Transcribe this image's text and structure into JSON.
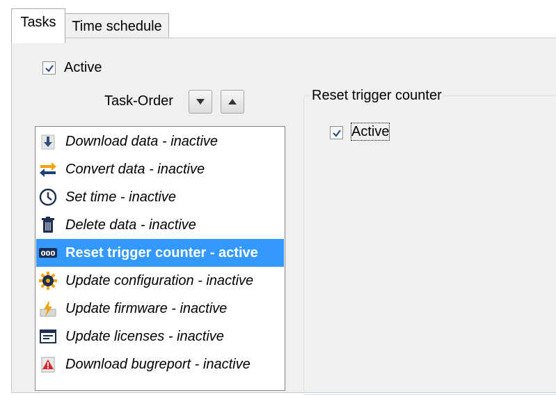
{
  "tabs": [
    {
      "label": "Tasks",
      "active": true
    },
    {
      "label": "Time schedule",
      "active": false
    }
  ],
  "main_active": {
    "label": "Active",
    "checked": true
  },
  "task_order": {
    "label": "Task-Order"
  },
  "tasks": [
    {
      "label": "Download data - inactive",
      "icon": "download-icon"
    },
    {
      "label": "Convert data - inactive",
      "icon": "convert-arrows-icon"
    },
    {
      "label": "Set time - inactive",
      "icon": "clock-icon"
    },
    {
      "label": "Delete data - inactive",
      "icon": "trash-icon"
    },
    {
      "label": "Reset trigger counter - active",
      "icon": "counter-icon",
      "selected": true
    },
    {
      "label": "Update configuration - inactive",
      "icon": "gear-icon"
    },
    {
      "label": "Update firmware - inactive",
      "icon": "firmware-icon"
    },
    {
      "label": "Update licenses - inactive",
      "icon": "license-icon"
    },
    {
      "label": "Download bugreport - inactive",
      "icon": "bugreport-icon"
    }
  ],
  "detail": {
    "title": "Reset trigger counter",
    "active_label": "Active",
    "active_checked": true
  },
  "colors": {
    "selection": "#3399ff",
    "panel": "#f0f0f0"
  }
}
